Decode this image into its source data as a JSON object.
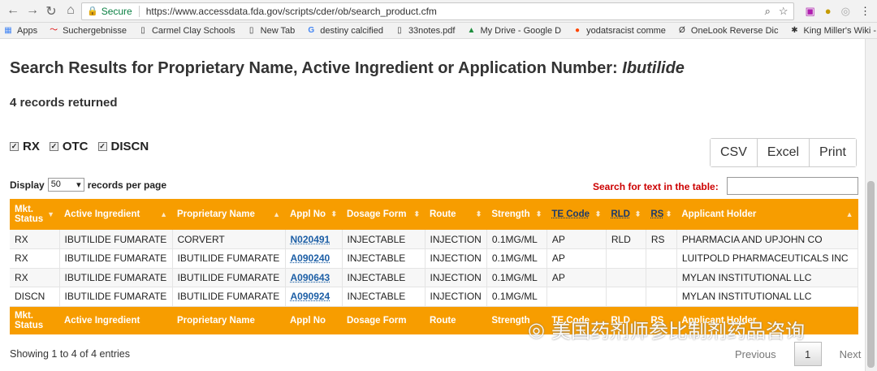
{
  "browser": {
    "secure_label": "Secure",
    "url": "https://www.accessdata.fda.gov/scripts/cder/ob/search_product.cfm",
    "bookmarks": [
      "Apps",
      "Suchergebnisse",
      "Carmel Clay Schools",
      "New Tab",
      "destiny calcified",
      "33notes.pdf",
      "My Drive - Google D",
      "yodatsracist comme",
      "OneLook Reverse Dic",
      "King Miller's Wiki - A"
    ]
  },
  "heading": {
    "text": "Search Results for Proprietary Name, Active Ingredient or Application Number:",
    "query": "Ibutilide"
  },
  "records_returned": "4 records returned",
  "filters": [
    "RX",
    "OTC",
    "DISCN"
  ],
  "export_buttons": [
    "CSV",
    "Excel",
    "Print"
  ],
  "display": {
    "prefix": "Display",
    "value": "50",
    "suffix": "records per page"
  },
  "search": {
    "label": "Search for text in the table:"
  },
  "table": {
    "headers": [
      "Mkt. Status",
      "Active Ingredient",
      "Proprietary Name",
      "Appl No",
      "Dosage Form",
      "Route",
      "Strength",
      "TE Code",
      "RLD",
      "RS",
      "Applicant Holder"
    ],
    "rows": [
      [
        "RX",
        "IBUTILIDE FUMARATE",
        "CORVERT",
        "N020491",
        "INJECTABLE",
        "INJECTION",
        "0.1MG/ML",
        "AP",
        "RLD",
        "RS",
        "PHARMACIA AND UPJOHN CO"
      ],
      [
        "RX",
        "IBUTILIDE FUMARATE",
        "IBUTILIDE FUMARATE",
        "A090240",
        "INJECTABLE",
        "INJECTION",
        "0.1MG/ML",
        "AP",
        "",
        "",
        "LUITPOLD PHARMACEUTICALS INC"
      ],
      [
        "RX",
        "IBUTILIDE FUMARATE",
        "IBUTILIDE FUMARATE",
        "A090643",
        "INJECTABLE",
        "INJECTION",
        "0.1MG/ML",
        "AP",
        "",
        "",
        "MYLAN INSTITUTIONAL LLC"
      ],
      [
        "DISCN",
        "IBUTILIDE FUMARATE",
        "IBUTILIDE FUMARATE",
        "A090924",
        "INJECTABLE",
        "INJECTION",
        "0.1MG/ML",
        "",
        "",
        "",
        "MYLAN INSTITUTIONAL LLC"
      ]
    ]
  },
  "pagination": {
    "showing": "Showing 1 to 4 of 4 entries",
    "previous": "Previous",
    "page": "1",
    "next": "Next"
  },
  "watermark": "美国药剂师参比制剂药品咨询"
}
